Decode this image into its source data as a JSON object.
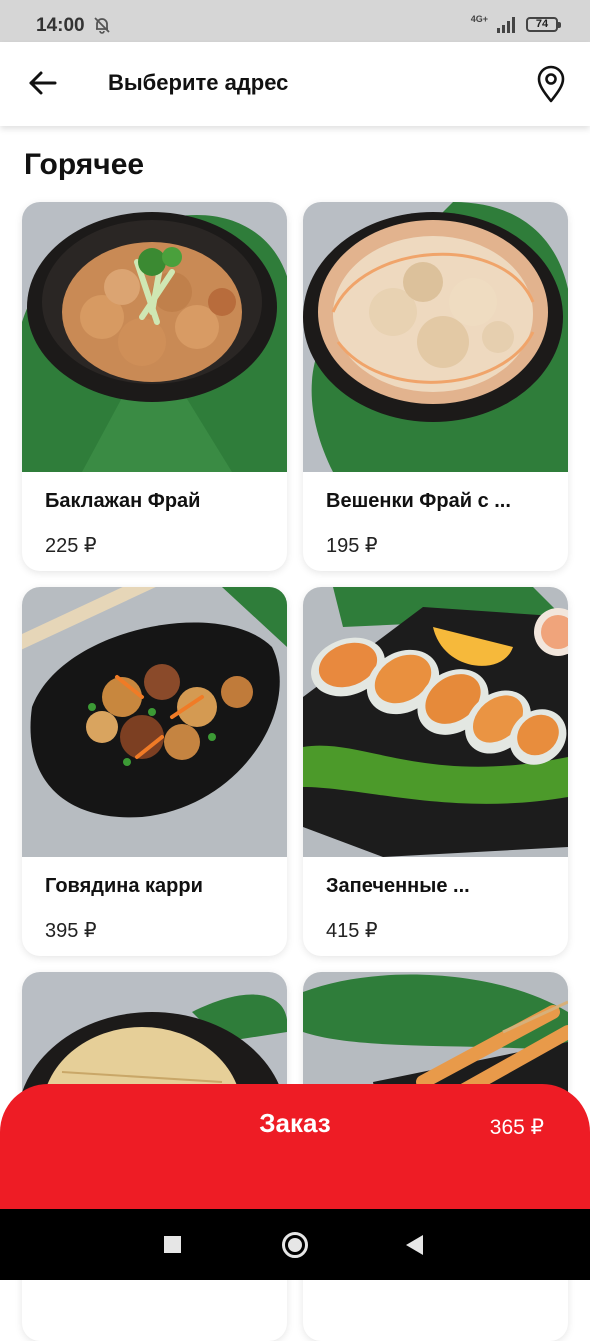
{
  "status_bar": {
    "time": "14:00",
    "network": "4G+",
    "battery": "74"
  },
  "header": {
    "title": "Выберите адрес",
    "back_icon": "arrow-left-icon",
    "location_icon": "map-pin-icon"
  },
  "section": {
    "title": "Горячее"
  },
  "products": [
    {
      "name": "Баклажан Фрай",
      "price": "225 ₽"
    },
    {
      "name": "Вешенки Фрай с ...",
      "price": "195 ₽"
    },
    {
      "name": "Говядина карри",
      "price": "395 ₽"
    },
    {
      "name": "Запеченные ...",
      "price": "415 ₽"
    },
    {
      "name": "",
      "price": ""
    },
    {
      "name": "",
      "price": ""
    }
  ],
  "order": {
    "label": "Заказ",
    "total": "365 ₽"
  },
  "colors": {
    "accent": "#ee1c25",
    "leaf": "#2f7d3a",
    "table": "#b9bec4"
  }
}
